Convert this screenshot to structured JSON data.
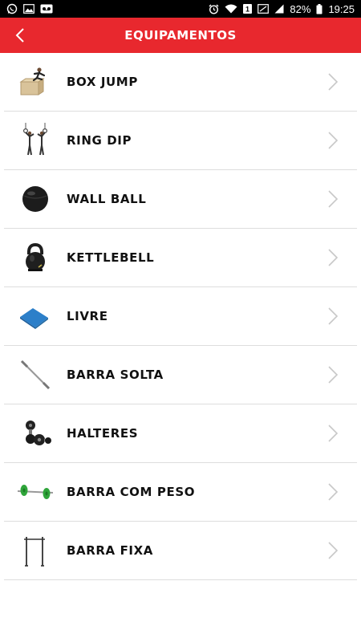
{
  "status_bar": {
    "battery": "82%",
    "time": "19:25",
    "sim_badge": "1",
    "icons": [
      "whatsapp-icon",
      "gallery-icon",
      "voicemail-icon",
      "alarm-icon",
      "wifi-icon",
      "sim-icon",
      "screen-icon",
      "signal-icon",
      "battery-icon"
    ]
  },
  "header": {
    "title": "EQUIPAMENTOS",
    "back_icon": "chevron-left-icon"
  },
  "colors": {
    "accent": "#e8282e",
    "text": "#111111",
    "divider": "#dddddd",
    "chevron": "#c8c8c8"
  },
  "equipment": [
    {
      "label": "BOX JUMP",
      "icon": "box-jump-icon"
    },
    {
      "label": "RING DIP",
      "icon": "ring-dip-icon"
    },
    {
      "label": "WALL BALL",
      "icon": "wall-ball-icon"
    },
    {
      "label": "KETTLEBELL",
      "icon": "kettlebell-icon"
    },
    {
      "label": "LIVRE",
      "icon": "mat-icon"
    },
    {
      "label": "BARRA SOLTA",
      "icon": "barbell-icon"
    },
    {
      "label": "HALTERES",
      "icon": "dumbbells-icon"
    },
    {
      "label": "BARRA COM PESO",
      "icon": "weighted-barbell-icon"
    },
    {
      "label": "BARRA FIXA",
      "icon": "pullup-bar-icon"
    }
  ]
}
